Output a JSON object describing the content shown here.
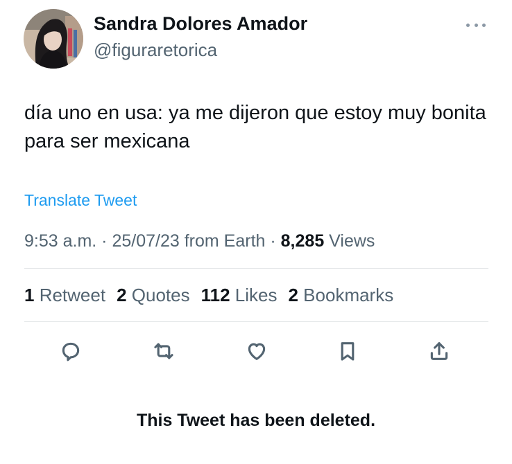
{
  "author": {
    "display_name": "Sandra Dolores Amador",
    "handle": "@figuraretorica"
  },
  "tweet": {
    "text": "día uno en usa: ya me dijeron que estoy muy bonita para ser mexicana",
    "translate_label": "Translate Tweet"
  },
  "meta": {
    "time": "9:53 a.m.",
    "sep1": " · ",
    "date": "25/07/23",
    "source": " from Earth",
    "sep2": " · ",
    "views_count": "8,285",
    "views_label": " Views"
  },
  "stats": [
    {
      "count": "1",
      "label": " Retweet"
    },
    {
      "count": "2",
      "label": " Quotes"
    },
    {
      "count": "112",
      "label": " Likes"
    },
    {
      "count": "2",
      "label": " Bookmarks"
    }
  ],
  "actions": [
    "reply-icon",
    "retweet-icon",
    "like-icon",
    "bookmark-icon",
    "share-icon"
  ],
  "deleted_notice": "This Tweet has been deleted.",
  "colors": {
    "link": "#1d9bf0",
    "secondary_text": "#536471",
    "primary_text": "#0f1419",
    "divider": "#e3e6e8"
  }
}
